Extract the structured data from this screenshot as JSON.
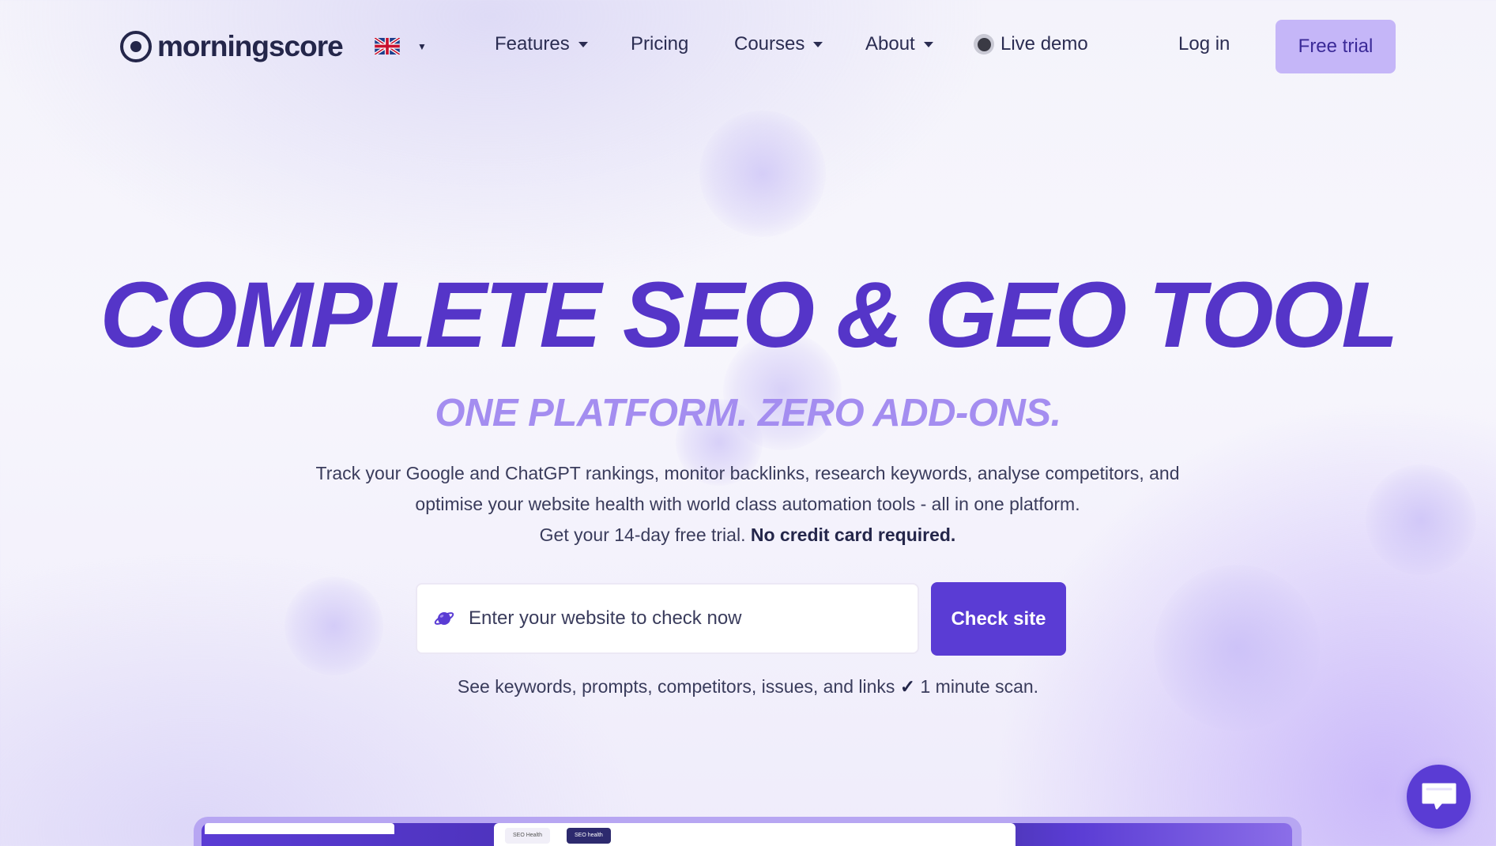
{
  "brand": {
    "name": "morningscore"
  },
  "nav": {
    "language": "English (UK)",
    "items": [
      {
        "label": "Features",
        "has_dropdown": true
      },
      {
        "label": "Pricing",
        "has_dropdown": false
      },
      {
        "label": "Courses",
        "has_dropdown": true
      },
      {
        "label": "About",
        "has_dropdown": true
      },
      {
        "label": "Live demo",
        "has_dropdown": false
      }
    ],
    "login_label": "Log in",
    "cta_label": "Free trial"
  },
  "hero": {
    "title": "COMPLETE SEO & GEO TOOL",
    "subtitle": "ONE PLATFORM. ZERO ADD-ONS.",
    "description_line1": "Track your Google and ChatGPT rankings, monitor backlinks, research keywords, analyse competitors, and",
    "description_line2": "optimise your website health with world class automation tools - all in one platform.",
    "trial_text": "Get your 14-day free trial.",
    "trial_emphasis": "No credit card required."
  },
  "search": {
    "placeholder": "Enter your website to check now",
    "value": "",
    "button_label": "Check site"
  },
  "scan_note": {
    "text": "See keywords, prompts, competitors, issues, and links",
    "check": "✓",
    "duration": "1 minute scan."
  },
  "preview": {
    "tabs": [
      "SEO Health",
      "SEO health"
    ]
  },
  "colors": {
    "primary": "#5a3cd4",
    "title": "#5535c8",
    "subtitle": "#a48df0",
    "cta_bg": "#c5b6f8",
    "text": "#2b2d52"
  },
  "icons": {
    "logo": "morningscore-logo-icon",
    "language": "uk-flag-icon",
    "live_demo": "record-icon",
    "search": "planet-icon",
    "chat": "chat-icon"
  }
}
